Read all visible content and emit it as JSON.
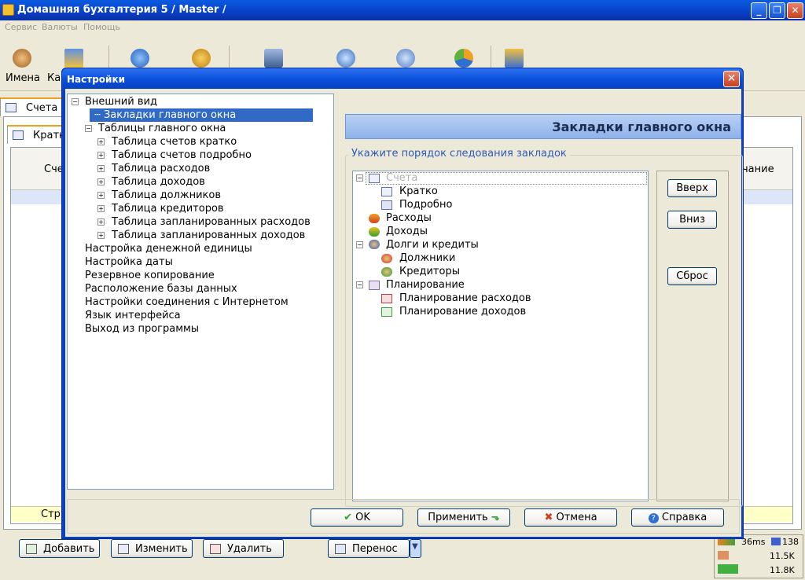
{
  "window": {
    "title": "Домашняя бухгалтерия 5  / Master /",
    "minimize": "_",
    "restore": "❐",
    "close": "✕"
  },
  "menu": [
    "Сервис",
    "Валюты",
    "Помощь"
  ],
  "toolbar": {
    "item1": "Имена",
    "item2": "Ка"
  },
  "background": {
    "tab_accounts": "Счета",
    "subtab_brief": "Кратк",
    "col_left": "Сче",
    "col_right": "ечание",
    "footer_row": "Стр"
  },
  "bottom_buttons": {
    "add": "Добавить",
    "edit": "Изменить",
    "delete": "Удалить",
    "transfer": "Перенос"
  },
  "status": {
    "ping": "36ms",
    "count": "138",
    "val1": "11.5K",
    "val2": "11.8K"
  },
  "dialog": {
    "title": "Настройки",
    "close": "✕",
    "header": "Закладки главного окна",
    "group_label": "Укажите порядок следования закладок",
    "tree": [
      "Внешний вид",
      "Закладки главного окна",
      "Таблицы главного окна",
      "Таблица счетов кратко",
      "Таблица счетов подробно",
      "Таблица расходов",
      "Таблица доходов",
      "Таблица должников",
      "Таблица кредиторов",
      "Таблица запланированных расходов",
      "Таблица запланированных доходов",
      "Настройка денежной единицы",
      "Настройка даты",
      "Резервное копирование",
      "Расположение базы данных",
      "Настройки соединения с Интернетом",
      "Язык интерфейса",
      "Выход из программы"
    ],
    "order": [
      "Счета",
      "Кратко",
      "Подробно",
      "Расходы",
      "Доходы",
      "Долги и кредиты",
      "Должники",
      "Кредиторы",
      "Планирование",
      "Планирование расходов",
      "Планирование доходов"
    ],
    "buttons": {
      "up": "Вверх",
      "down": "Вниз",
      "reset": "Сброс",
      "ok": "OK",
      "apply": "Применить",
      "cancel": "Отмена",
      "help": "Справка"
    }
  }
}
